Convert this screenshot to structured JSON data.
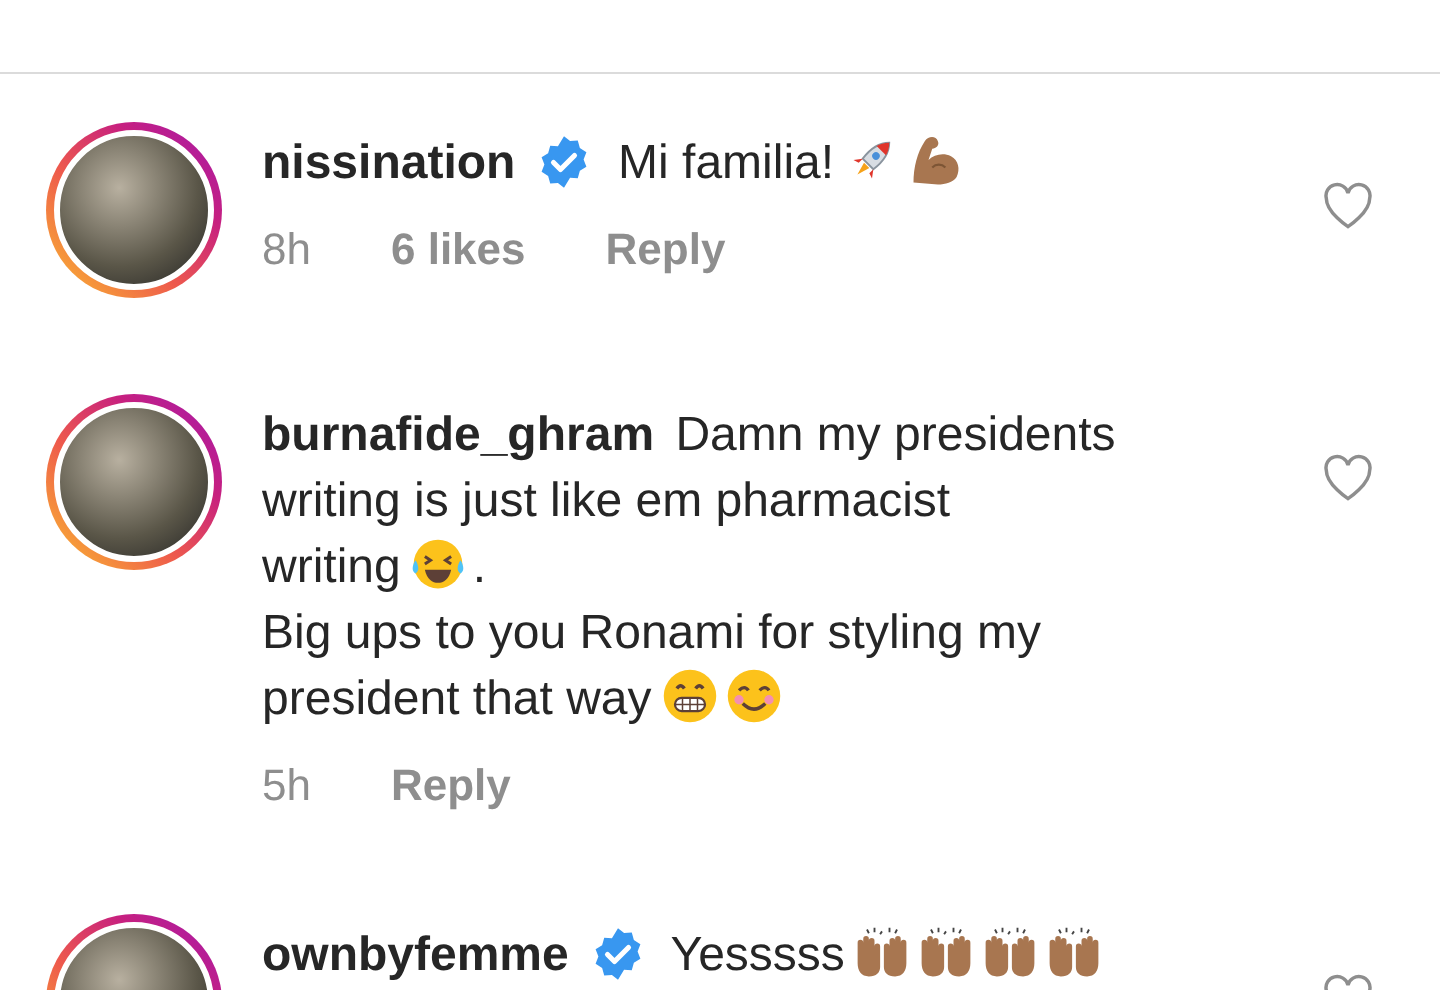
{
  "comments": [
    {
      "username": "nissination",
      "verified": true,
      "story_ring": true,
      "liked": false,
      "body": [
        {
          "kind": "text",
          "text": "Mi familia!"
        },
        {
          "kind": "rocket"
        },
        {
          "kind": "biceps"
        }
      ],
      "time": "8h",
      "likes": "6 likes",
      "reply": "Reply"
    },
    {
      "username": "burnafide_ghram",
      "verified": false,
      "story_ring": true,
      "liked": false,
      "body": [
        {
          "kind": "text",
          "text": "Damn my presidents"
        },
        {
          "kind": "break"
        },
        {
          "kind": "text",
          "text": "writing is just like em pharmacist"
        },
        {
          "kind": "break"
        },
        {
          "kind": "text",
          "text": "writing"
        },
        {
          "kind": "laughing"
        },
        {
          "kind": "text",
          "text": "."
        },
        {
          "kind": "break"
        },
        {
          "kind": "text",
          "text": "Big ups to you Ronami for styling my"
        },
        {
          "kind": "break"
        },
        {
          "kind": "text",
          "text": "president that way"
        },
        {
          "kind": "grinning"
        },
        {
          "kind": "smiling"
        }
      ],
      "time": "5h",
      "reply": "Reply"
    },
    {
      "username": "ownbyfemme",
      "verified": true,
      "story_ring": true,
      "liked": false,
      "body": [
        {
          "kind": "text",
          "text": "Yesssss"
        },
        {
          "kind": "raised-hands"
        },
        {
          "kind": "raised-hands"
        },
        {
          "kind": "raised-hands"
        },
        {
          "kind": "raised-hands"
        }
      ]
    }
  ]
}
